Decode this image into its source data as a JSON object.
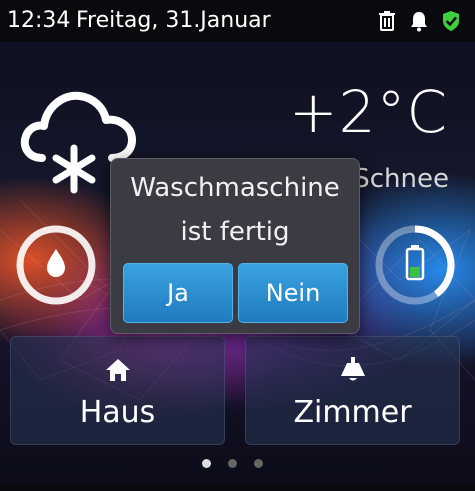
{
  "statusbar": {
    "time": "12:34",
    "date": "Freitag, 31.Januar",
    "icons": [
      "trash-icon",
      "bell-icon",
      "shield-check-icon"
    ],
    "shield_color": "#3ecf3e"
  },
  "weather": {
    "icon": "snow-cloud-icon",
    "temperature": "+2°C",
    "condition": "Schnee"
  },
  "gauges": {
    "humidity_icon": "water-drop-icon",
    "battery_icon": "battery-icon",
    "battery_level": 0.4,
    "battery_color": "#3fbf3f"
  },
  "dialog": {
    "line1": "Waschmaschine",
    "line2": "ist fertig",
    "yes_label": "Ja",
    "no_label": "Nein"
  },
  "tiles": [
    {
      "label": "Haus",
      "icon": "home-icon"
    },
    {
      "label": "Zimmer",
      "icon": "lamp-icon"
    }
  ],
  "pagination": {
    "pages": 3,
    "active": 1
  }
}
